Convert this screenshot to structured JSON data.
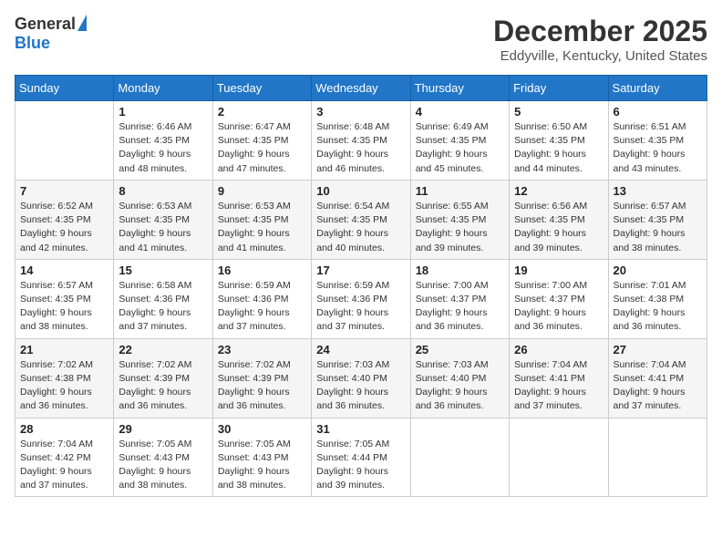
{
  "logo": {
    "general": "General",
    "blue": "Blue"
  },
  "title": "December 2025",
  "subtitle": "Eddyville, Kentucky, United States",
  "days_of_week": [
    "Sunday",
    "Monday",
    "Tuesday",
    "Wednesday",
    "Thursday",
    "Friday",
    "Saturday"
  ],
  "weeks": [
    [
      {
        "day": "",
        "sunrise": "",
        "sunset": "",
        "daylight": ""
      },
      {
        "day": "1",
        "sunrise": "6:46 AM",
        "sunset": "4:35 PM",
        "daylight": "9 hours and 48 minutes."
      },
      {
        "day": "2",
        "sunrise": "6:47 AM",
        "sunset": "4:35 PM",
        "daylight": "9 hours and 47 minutes."
      },
      {
        "day": "3",
        "sunrise": "6:48 AM",
        "sunset": "4:35 PM",
        "daylight": "9 hours and 46 minutes."
      },
      {
        "day": "4",
        "sunrise": "6:49 AM",
        "sunset": "4:35 PM",
        "daylight": "9 hours and 45 minutes."
      },
      {
        "day": "5",
        "sunrise": "6:50 AM",
        "sunset": "4:35 PM",
        "daylight": "9 hours and 44 minutes."
      },
      {
        "day": "6",
        "sunrise": "6:51 AM",
        "sunset": "4:35 PM",
        "daylight": "9 hours and 43 minutes."
      }
    ],
    [
      {
        "day": "7",
        "sunrise": "6:52 AM",
        "sunset": "4:35 PM",
        "daylight": "9 hours and 42 minutes."
      },
      {
        "day": "8",
        "sunrise": "6:53 AM",
        "sunset": "4:35 PM",
        "daylight": "9 hours and 41 minutes."
      },
      {
        "day": "9",
        "sunrise": "6:53 AM",
        "sunset": "4:35 PM",
        "daylight": "9 hours and 41 minutes."
      },
      {
        "day": "10",
        "sunrise": "6:54 AM",
        "sunset": "4:35 PM",
        "daylight": "9 hours and 40 minutes."
      },
      {
        "day": "11",
        "sunrise": "6:55 AM",
        "sunset": "4:35 PM",
        "daylight": "9 hours and 39 minutes."
      },
      {
        "day": "12",
        "sunrise": "6:56 AM",
        "sunset": "4:35 PM",
        "daylight": "9 hours and 39 minutes."
      },
      {
        "day": "13",
        "sunrise": "6:57 AM",
        "sunset": "4:35 PM",
        "daylight": "9 hours and 38 minutes."
      }
    ],
    [
      {
        "day": "14",
        "sunrise": "6:57 AM",
        "sunset": "4:35 PM",
        "daylight": "9 hours and 38 minutes."
      },
      {
        "day": "15",
        "sunrise": "6:58 AM",
        "sunset": "4:36 PM",
        "daylight": "9 hours and 37 minutes."
      },
      {
        "day": "16",
        "sunrise": "6:59 AM",
        "sunset": "4:36 PM",
        "daylight": "9 hours and 37 minutes."
      },
      {
        "day": "17",
        "sunrise": "6:59 AM",
        "sunset": "4:36 PM",
        "daylight": "9 hours and 37 minutes."
      },
      {
        "day": "18",
        "sunrise": "7:00 AM",
        "sunset": "4:37 PM",
        "daylight": "9 hours and 36 minutes."
      },
      {
        "day": "19",
        "sunrise": "7:00 AM",
        "sunset": "4:37 PM",
        "daylight": "9 hours and 36 minutes."
      },
      {
        "day": "20",
        "sunrise": "7:01 AM",
        "sunset": "4:38 PM",
        "daylight": "9 hours and 36 minutes."
      }
    ],
    [
      {
        "day": "21",
        "sunrise": "7:02 AM",
        "sunset": "4:38 PM",
        "daylight": "9 hours and 36 minutes."
      },
      {
        "day": "22",
        "sunrise": "7:02 AM",
        "sunset": "4:39 PM",
        "daylight": "9 hours and 36 minutes."
      },
      {
        "day": "23",
        "sunrise": "7:02 AM",
        "sunset": "4:39 PM",
        "daylight": "9 hours and 36 minutes."
      },
      {
        "day": "24",
        "sunrise": "7:03 AM",
        "sunset": "4:40 PM",
        "daylight": "9 hours and 36 minutes."
      },
      {
        "day": "25",
        "sunrise": "7:03 AM",
        "sunset": "4:40 PM",
        "daylight": "9 hours and 36 minutes."
      },
      {
        "day": "26",
        "sunrise": "7:04 AM",
        "sunset": "4:41 PM",
        "daylight": "9 hours and 37 minutes."
      },
      {
        "day": "27",
        "sunrise": "7:04 AM",
        "sunset": "4:41 PM",
        "daylight": "9 hours and 37 minutes."
      }
    ],
    [
      {
        "day": "28",
        "sunrise": "7:04 AM",
        "sunset": "4:42 PM",
        "daylight": "9 hours and 37 minutes."
      },
      {
        "day": "29",
        "sunrise": "7:05 AM",
        "sunset": "4:43 PM",
        "daylight": "9 hours and 38 minutes."
      },
      {
        "day": "30",
        "sunrise": "7:05 AM",
        "sunset": "4:43 PM",
        "daylight": "9 hours and 38 minutes."
      },
      {
        "day": "31",
        "sunrise": "7:05 AM",
        "sunset": "4:44 PM",
        "daylight": "9 hours and 39 minutes."
      },
      {
        "day": "",
        "sunrise": "",
        "sunset": "",
        "daylight": ""
      },
      {
        "day": "",
        "sunrise": "",
        "sunset": "",
        "daylight": ""
      },
      {
        "day": "",
        "sunrise": "",
        "sunset": "",
        "daylight": ""
      }
    ]
  ],
  "labels": {
    "sunrise_prefix": "Sunrise: ",
    "sunset_prefix": "Sunset: ",
    "daylight_prefix": "Daylight: "
  }
}
